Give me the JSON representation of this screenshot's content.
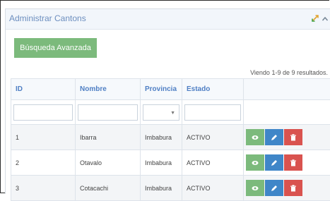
{
  "panel": {
    "title": "Administrar Cantons"
  },
  "toolbar": {
    "advanced_search_label": "Búsqueda Avanzada"
  },
  "results_text": "Viendo 1-9 de 9 resultados.",
  "table": {
    "columns": [
      "ID",
      "Nombre",
      "Provincia",
      "Estado",
      ""
    ],
    "rows": [
      {
        "id": "1",
        "nombre": "Ibarra",
        "provincia": "Imbabura",
        "estado": "ACTIVO"
      },
      {
        "id": "2",
        "nombre": "Otavalo",
        "provincia": "Imbabura",
        "estado": "ACTIVO"
      },
      {
        "id": "3",
        "nombre": "Cotacachi",
        "provincia": "Imbabura",
        "estado": "ACTIVO"
      }
    ]
  },
  "icons": {
    "expand": "expand-icon",
    "collapse": "chevron-up-icon",
    "view": "eye-icon",
    "edit": "pencil-icon",
    "delete": "trash-icon"
  },
  "colors": {
    "accent": "#6c8ebf",
    "header_text": "#4f7fc4",
    "green": "#7cba7c",
    "blue": "#3f86c8",
    "red": "#d9534f"
  }
}
